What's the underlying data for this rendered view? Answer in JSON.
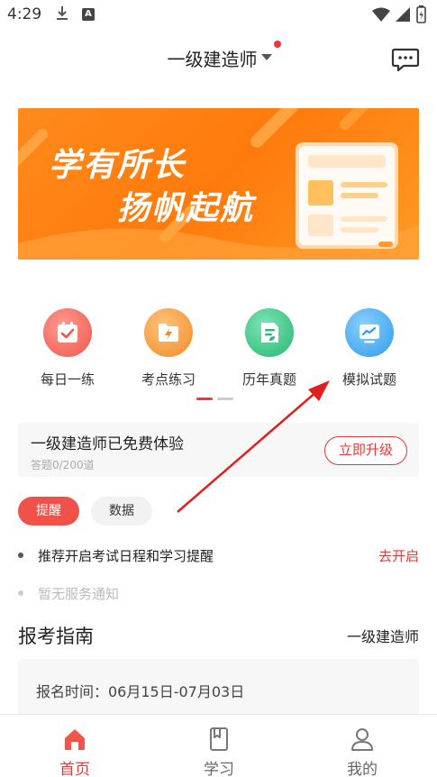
{
  "status_bar": {
    "time": "4:29",
    "notif_letter": "A"
  },
  "header": {
    "title": "一级建造师"
  },
  "banner": {
    "line1": "学有所长",
    "line2": "扬帆起航"
  },
  "quick_actions": [
    {
      "label": "每日一练",
      "icon": "calendar-check-icon"
    },
    {
      "label": "考点练习",
      "icon": "lightning-folder-icon"
    },
    {
      "label": "历年真题",
      "icon": "document-leaf-icon"
    },
    {
      "label": "模拟试题",
      "icon": "monitor-chart-icon"
    }
  ],
  "trial": {
    "title": "一级建造师已免费体验",
    "progress": "答题0/200道",
    "upgrade_label": "立即升级"
  },
  "tabs_small": {
    "reminder": "提醒",
    "data": "数据"
  },
  "notices": [
    {
      "text": "推荐开启考试日程和学习提醒",
      "action": "去开启"
    },
    {
      "text": "暂无服务通知"
    }
  ],
  "guide": {
    "title": "报考指南",
    "exam": "一级建造师",
    "date_line": "报名时间：06月15日-07月03日"
  },
  "tabbar": [
    {
      "label": "首页",
      "active": true
    },
    {
      "label": "学习",
      "active": false
    },
    {
      "label": "我的",
      "active": false
    }
  ],
  "colors": {
    "accent": "#e23a37",
    "banner": "#ff8a1c"
  }
}
